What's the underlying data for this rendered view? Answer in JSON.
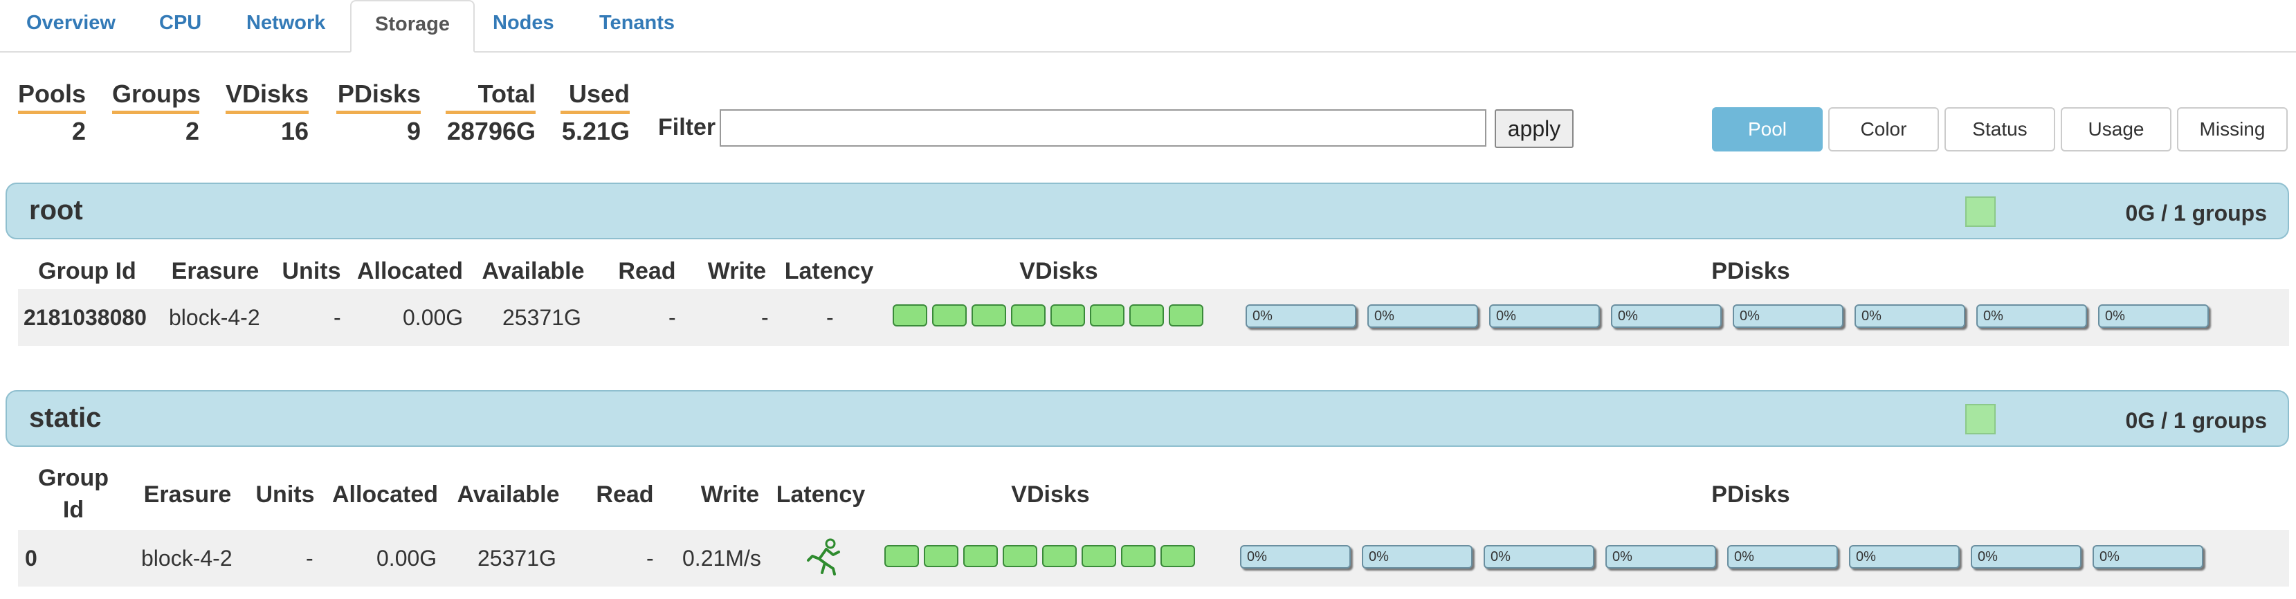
{
  "tabs": [
    "Overview",
    "CPU",
    "Network",
    "Storage",
    "Nodes",
    "Tenants"
  ],
  "active_tab": "Storage",
  "stats": [
    {
      "label": "Pools",
      "value": "2"
    },
    {
      "label": "Groups",
      "value": "2"
    },
    {
      "label": "VDisks",
      "value": "16"
    },
    {
      "label": "PDisks",
      "value": "9"
    },
    {
      "label": "Total",
      "value": "28796G"
    },
    {
      "label": "Used",
      "value": "5.21G"
    }
  ],
  "filter": {
    "label": "Filter",
    "value": "",
    "placeholder": "",
    "apply_label": "apply"
  },
  "view_buttons": [
    "Pool",
    "Color",
    "Status",
    "Usage",
    "Missing"
  ],
  "active_view": "Pool",
  "colors": {
    "header_bg": "#bfe0ea",
    "vdisk_ok": "#8ee07f",
    "active_button": "#6fb8d9",
    "stat_underline": "#f0ad4e"
  },
  "pools": [
    {
      "name": "root",
      "summary": "0G / 1 groups",
      "columns": {
        "group_id": "Group Id",
        "erasure": "Erasure",
        "units": "Units",
        "allocated": "Allocated",
        "available": "Available",
        "read": "Read",
        "write": "Write",
        "latency": "Latency",
        "vdisks": "VDisks",
        "pdisks": "PDisks"
      },
      "row": {
        "group_id": "2181038080",
        "erasure": "block-4-2",
        "units": "-",
        "allocated": "0.00G",
        "available": "25371G",
        "read": "-",
        "write": "-",
        "latency": "-",
        "latency_icon": null,
        "vdisk_count": 8,
        "pdisks": [
          "0%",
          "0%",
          "0%",
          "0%",
          "0%",
          "0%",
          "0%",
          "0%"
        ]
      }
    },
    {
      "name": "static",
      "summary": "0G / 1 groups",
      "columns": {
        "group_id_line1": "Group",
        "group_id_line2": "Id",
        "erasure": "Erasure",
        "units": "Units",
        "allocated": "Allocated",
        "available": "Available",
        "read": "Read",
        "write": "Write",
        "latency": "Latency",
        "vdisks": "VDisks",
        "pdisks": "PDisks"
      },
      "row": {
        "group_id": "0",
        "erasure": "block-4-2",
        "units": "-",
        "allocated": "0.00G",
        "available": "25371G",
        "read": "-",
        "write": "0.21M/s",
        "latency": "",
        "latency_icon": "running-man-icon",
        "vdisk_count": 8,
        "pdisks": [
          "0%",
          "0%",
          "0%",
          "0%",
          "0%",
          "0%",
          "0%",
          "0%"
        ]
      }
    }
  ]
}
